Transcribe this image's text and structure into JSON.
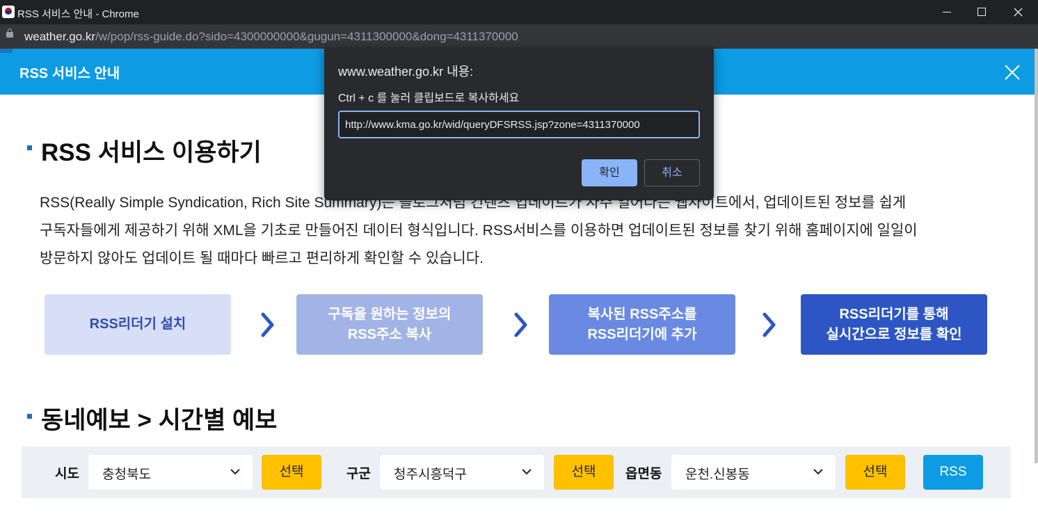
{
  "window": {
    "title": "RSS 서비스 안내 - Chrome"
  },
  "address_bar": {
    "host": "weather.go.kr",
    "path": "/w/pop/rss-guide.do?sido=4300000000&gugun=4311300000&dong=4311370000"
  },
  "header": {
    "title": "RSS 서비스 안내"
  },
  "section1": {
    "title": "RSS 서비스 이용하기",
    "paragraph": [
      "RSS(Really Simple Syndication, Rich Site Summary)는 블로그처럼 컨텐츠 업데이트가 자주 일어나는 웹사이트에서, 업데이트된 정보를 쉽게",
      "구독자들에게 제공하기 위해 XML을 기초로 만들어진 데이터 형식입니다. RSS서비스를 이용하면 업데이트된 정보를 찾기 위해 홈페이지에 일일이",
      "방문하지 않아도 업데이트 될 때마다 빠르고 편리하게 확인할 수 있습니다."
    ],
    "steps": [
      {
        "label": "RSS리더기 설치",
        "bg": "#d7def7",
        "fg": "#2f4dad"
      },
      {
        "label": "구독을 원하는 정보의\nRSS주소 복사",
        "bg": "#a2b4e6",
        "fg": "#ffffff"
      },
      {
        "label": "복사된 RSS주소를\nRSS리더기에 추가",
        "bg": "#6a89e2",
        "fg": "#ffffff"
      },
      {
        "label": "RSS리더기를 통해\n실시간으로 정보를 확인",
        "bg": "#2d56c4",
        "fg": "#ffffff"
      }
    ],
    "arrow_icon": "chevron-right-icon"
  },
  "section2": {
    "title": "동네예보 > 시간별 예보",
    "sido": {
      "label": "시도",
      "value": "충청북도",
      "button": "선택"
    },
    "gugun": {
      "label": "구군",
      "value": "청주시흥덕구",
      "button": "선택"
    },
    "dong": {
      "label": "읍면동",
      "value": "운천.신봉동",
      "button": "선택"
    },
    "rss_button": "RSS"
  },
  "dialog": {
    "title": "www.weather.go.kr 내용:",
    "message": "Ctrl + c 를 눌러 클립보드로 복사하세요",
    "input_value": "http://www.kma.go.kr/wid/queryDFSRSS.jsp?zone=4311370000",
    "ok_label": "확인",
    "cancel_label": "취소"
  },
  "colors": {
    "header_blue": "#0d9be3",
    "select_yellow": "#ffc000",
    "dialog_bg": "#292a2d",
    "dialog_accent": "#8ab4f8"
  }
}
